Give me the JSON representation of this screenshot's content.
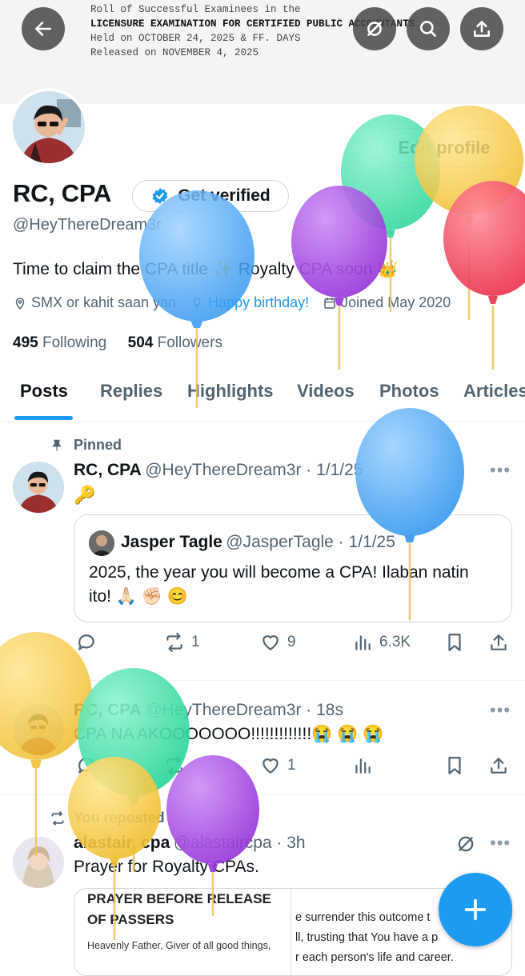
{
  "banner": {
    "line1": "Roll of Successful Examinees in the",
    "line2": "LICENSURE EXAMINATION FOR CERTIFIED PUBLIC ACCOUNTANTS",
    "line3": "Held on OCTOBER 24, 2025 & FF. DAYS",
    "line4": "Released on NOVEMBER 4, 2025"
  },
  "profile": {
    "display_name": "RC, CPA",
    "verify_label": "Get verified",
    "edit_label": "Edit profile",
    "handle": "@HeyThereDream3r",
    "bio": "Time to claim the CPA title ✨ Royalty CPA soon 👑",
    "location": "SMX or kahit saan yan",
    "birthday": "Happy birthday!",
    "joined": "Joined May 2020",
    "following_count": "495",
    "following_label": "Following",
    "followers_count": "504",
    "followers_label": "Followers"
  },
  "tabs": [
    "Posts",
    "Replies",
    "Highlights",
    "Videos",
    "Photos",
    "Articles"
  ],
  "posts": [
    {
      "pinned_label": "Pinned",
      "name": "RC, CPA",
      "handle_time": "@HeyThereDream3r · 1/1/25",
      "text": "🔑",
      "quote": {
        "name": "Jasper Tagle",
        "handle_time": "@JasperTagle · 1/1/25",
        "text_line1": "2025, the year you will become a CPA! Ilaban natin",
        "text_line2": "ito! 🙏🏻 ✊🏻 😊"
      },
      "reposts": "1",
      "likes": "9",
      "views": "6.3K"
    },
    {
      "name": "RC, CPA",
      "handle_time": "@HeyThereDream3r · 18s",
      "text": "CPA NA AKOOOOOOO!!!!!!!!!!!!!😭 😭 😭",
      "likes": "1"
    },
    {
      "repost_label": "You reposted",
      "name": "alastair, cpa",
      "handle_time": "@alastaircpa · 3h",
      "text": "Prayer for Royalty CPAs.",
      "card": {
        "left_title_line1": "PRAYER BEFORE RELEASE",
        "left_title_line2": "OF PASSERS",
        "left_body": "Heavenly Father, Giver of all good things,",
        "right_line1": "e surrender this outcome t",
        "right_line2": "ll, trusting that You have a p",
        "right_line3": "r each person's life and career."
      }
    }
  ],
  "colors": {
    "accent": "#1d9bf0",
    "balloon_blue": "#4aa8f2",
    "balloon_green": "#3fe0a5",
    "balloon_yellow": "#f5c842",
    "balloon_purple": "#a044e0",
    "balloon_red": "#f0405a"
  }
}
